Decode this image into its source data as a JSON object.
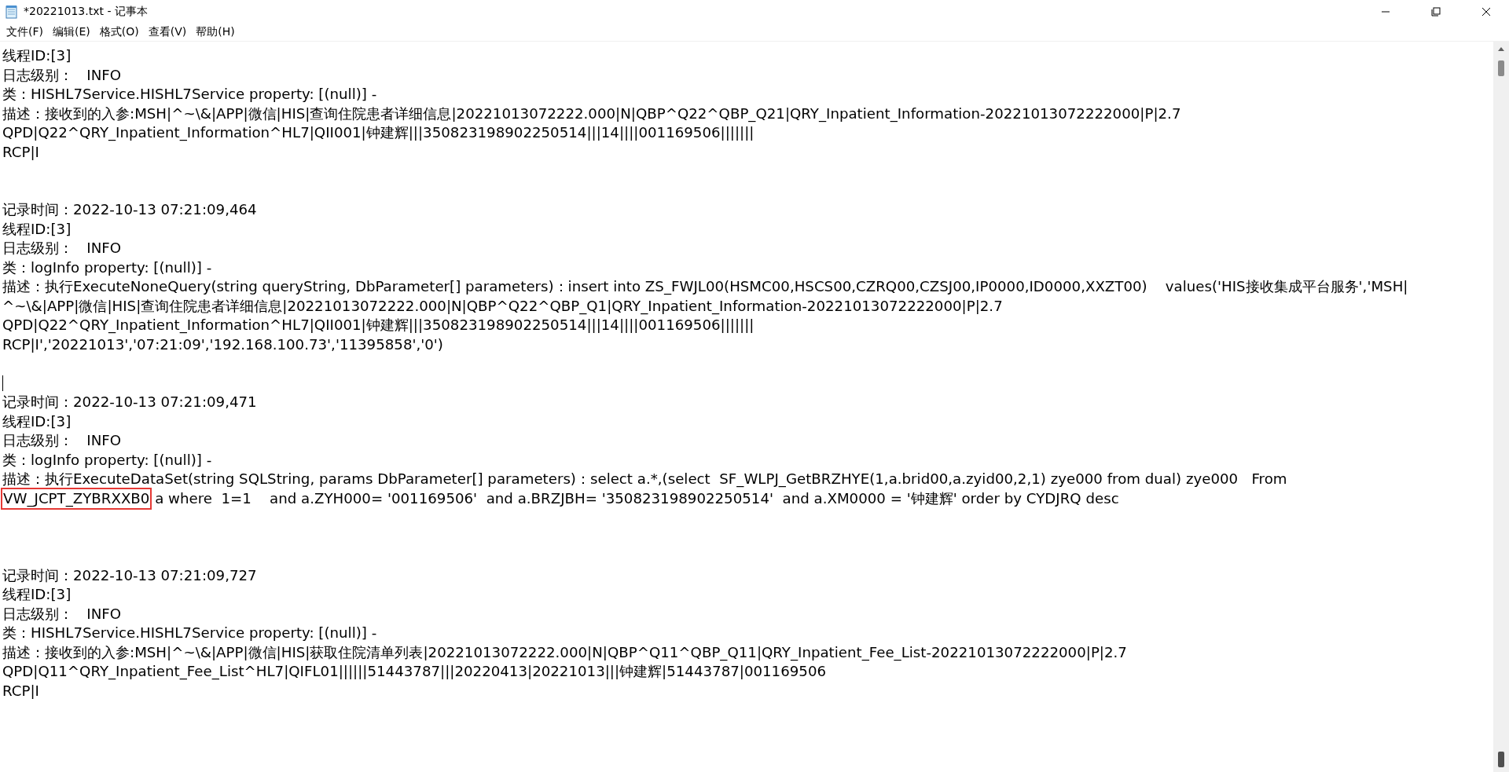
{
  "window": {
    "title": "*20221013.txt - 记事本"
  },
  "menu": [
    "文件(F)",
    "编辑(E)",
    "格式(O)",
    "查看(V)",
    "帮助(H)"
  ],
  "lines": [
    {
      "kind": "text",
      "text": "线程ID:[3]"
    },
    {
      "kind": "text",
      "text": "日志级别：   INFO"
    },
    {
      "kind": "text",
      "text": "类：HISHL7Service.HISHL7Service property: [(null)] -"
    },
    {
      "kind": "text",
      "text": "描述：接收到的入参:MSH|^~\\&|APP|微信|HIS|查询住院患者详细信息|20221013072222.000|N|QBP^Q22^QBP_Q21|QRY_Inpatient_Information-20221013072222000|P|2.7"
    },
    {
      "kind": "text",
      "text": "QPD|Q22^QRY_Inpatient_Information^HL7|QII001|钟建辉|||350823198902250514|||14||||001169506|||||||"
    },
    {
      "kind": "text",
      "text": "RCP|I"
    },
    {
      "kind": "blank"
    },
    {
      "kind": "blank"
    },
    {
      "kind": "text",
      "text": "记录时间：2022-10-13 07:21:09,464"
    },
    {
      "kind": "text",
      "text": "线程ID:[3]"
    },
    {
      "kind": "text",
      "text": "日志级别：   INFO"
    },
    {
      "kind": "text",
      "text": "类：logInfo property: [(null)] -"
    },
    {
      "kind": "text",
      "text": "描述：执行ExecuteNoneQuery(string queryString, DbParameter[] parameters)：insert into ZS_FWJL00(HSMC00,HSCS00,CZRQ00,CZSJ00,IP0000,ID0000,XXZT00)    values('HIS接收集成平台服务','MSH|"
    },
    {
      "kind": "text",
      "text": "^~\\&|APP|微信|HIS|查询住院患者详细信息|20221013072222.000|N|QBP^Q22^QBP_Q1|QRY_Inpatient_Information-20221013072222000|P|2.7"
    },
    {
      "kind": "text",
      "text": "QPD|Q22^QRY_Inpatient_Information^HL7|QII001|钟建辉|||350823198902250514|||14||||001169506|||||||"
    },
    {
      "kind": "text",
      "text": "RCP|I','20221013','07:21:09','192.168.100.73','11395858','0')"
    },
    {
      "kind": "blank"
    },
    {
      "kind": "caret"
    },
    {
      "kind": "text",
      "text": "记录时间：2022-10-13 07:21:09,471"
    },
    {
      "kind": "text",
      "text": "线程ID:[3]"
    },
    {
      "kind": "text",
      "text": "日志级别：   INFO"
    },
    {
      "kind": "text",
      "text": "类：logInfo property: [(null)] -"
    },
    {
      "kind": "text",
      "text": "描述：执行ExecuteDataSet(string SQLString, params DbParameter[] parameters)：select a.*,(select  SF_WLPJ_GetBRZHYE(1,a.brid00,a.zyid00,2,1) zye000 from dual) zye000   From"
    },
    {
      "kind": "marked",
      "marked": "VW_JCPT_ZYBRXXB0",
      "text": " a where  1=1    and a.ZYH000= '001169506'  and a.BRZJBH= '350823198902250514'  and a.XM0000 = '钟建辉' order by CYDJRQ desc"
    },
    {
      "kind": "blank"
    },
    {
      "kind": "blank"
    },
    {
      "kind": "blank"
    },
    {
      "kind": "text",
      "text": "记录时间：2022-10-13 07:21:09,727"
    },
    {
      "kind": "text",
      "text": "线程ID:[3]"
    },
    {
      "kind": "text",
      "text": "日志级别：   INFO"
    },
    {
      "kind": "text",
      "text": "类：HISHL7Service.HISHL7Service property: [(null)] -"
    },
    {
      "kind": "text",
      "text": "描述：接收到的入参:MSH|^~\\&|APP|微信|HIS|获取住院清单列表|20221013072222.000|N|QBP^Q11^QBP_Q11|QRY_Inpatient_Fee_List-20221013072222000|P|2.7"
    },
    {
      "kind": "text",
      "text": "QPD|Q11^QRY_Inpatient_Fee_List^HL7|QIFL01||||||51443787|||20220413|20221013|||钟建辉|51443787|001169506"
    },
    {
      "kind": "text",
      "text": "RCP|I"
    }
  ]
}
